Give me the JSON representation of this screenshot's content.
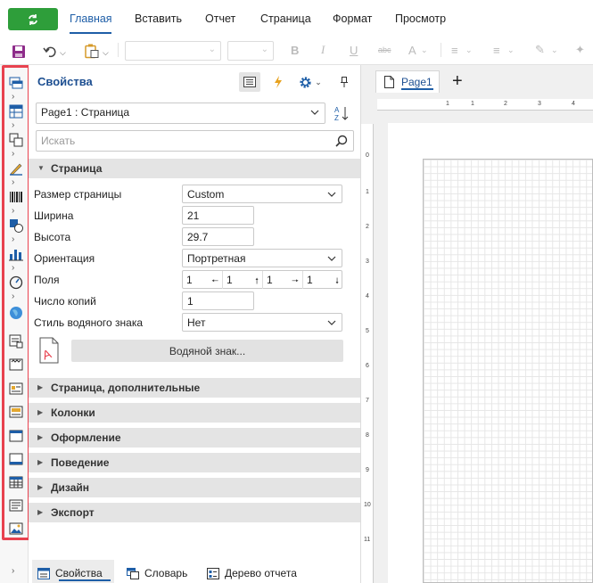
{
  "menu": {
    "items": [
      "Главная",
      "Вставить",
      "Отчет",
      "Страница",
      "Формат",
      "Просмотр"
    ],
    "active": "Главная"
  },
  "colors": {
    "accent": "#1e5ea7",
    "app_button": "#2e9e3a",
    "highlight": "#e8424f",
    "section_bg": "#e4e4e4"
  },
  "toolbar": {
    "icons": [
      "save-icon",
      "undo-icon",
      "paste-icon",
      "font-name-combo",
      "font-size-combo",
      "bold-icon",
      "italic-icon",
      "underline-icon",
      "strikethrough-icon",
      "font-color-icon",
      "align-left-icon",
      "align-center-icon",
      "format-painter-icon"
    ]
  },
  "toolbox": {
    "icons": [
      "band-icon",
      "cross-band-icon",
      "container-icon",
      "text-icon",
      "barcode-icon",
      "shape-icon",
      "chart-icon",
      "gauge-icon",
      "map-icon",
      "text-format-icon",
      "header-band-icon",
      "data-band-icon",
      "image-band-icon",
      "page-header-icon",
      "page-footer-icon",
      "table-icon",
      "rich-text-icon",
      "image-icon"
    ]
  },
  "properties": {
    "title": "Свойства",
    "object_selector": "Page1 : Страница",
    "search_placeholder": "Искать",
    "section_main": "Страница",
    "fields": {
      "page_size_label": "Размер страницы",
      "page_size_value": "Custom",
      "width_label": "Ширина",
      "width_value": "21",
      "height_label": "Высота",
      "height_value": "29.7",
      "orientation_label": "Ориентация",
      "orientation_value": "Портретная",
      "margins_label": "Поля",
      "margins_values": [
        "1",
        "1",
        "1",
        "1"
      ],
      "copies_label": "Число копий",
      "copies_value": "1",
      "watermark_style_label": "Стиль водяного знака",
      "watermark_style_value": "Нет"
    },
    "watermark_button": "Водяной знак...",
    "sections": [
      "Страница, дополнительные",
      "Колонки",
      "Оформление",
      "Поведение",
      "Дизайн",
      "Экспорт"
    ]
  },
  "bottom_tabs": [
    "Свойства",
    "Словарь",
    "Дерево отчета"
  ],
  "designer": {
    "page_tab": "Page1",
    "h_ruler": [
      "1",
      "1",
      "2",
      "3",
      "4"
    ],
    "v_ruler": [
      "0",
      "1",
      "2",
      "3",
      "4",
      "5",
      "6",
      "7",
      "8",
      "9",
      "10",
      "11"
    ]
  }
}
